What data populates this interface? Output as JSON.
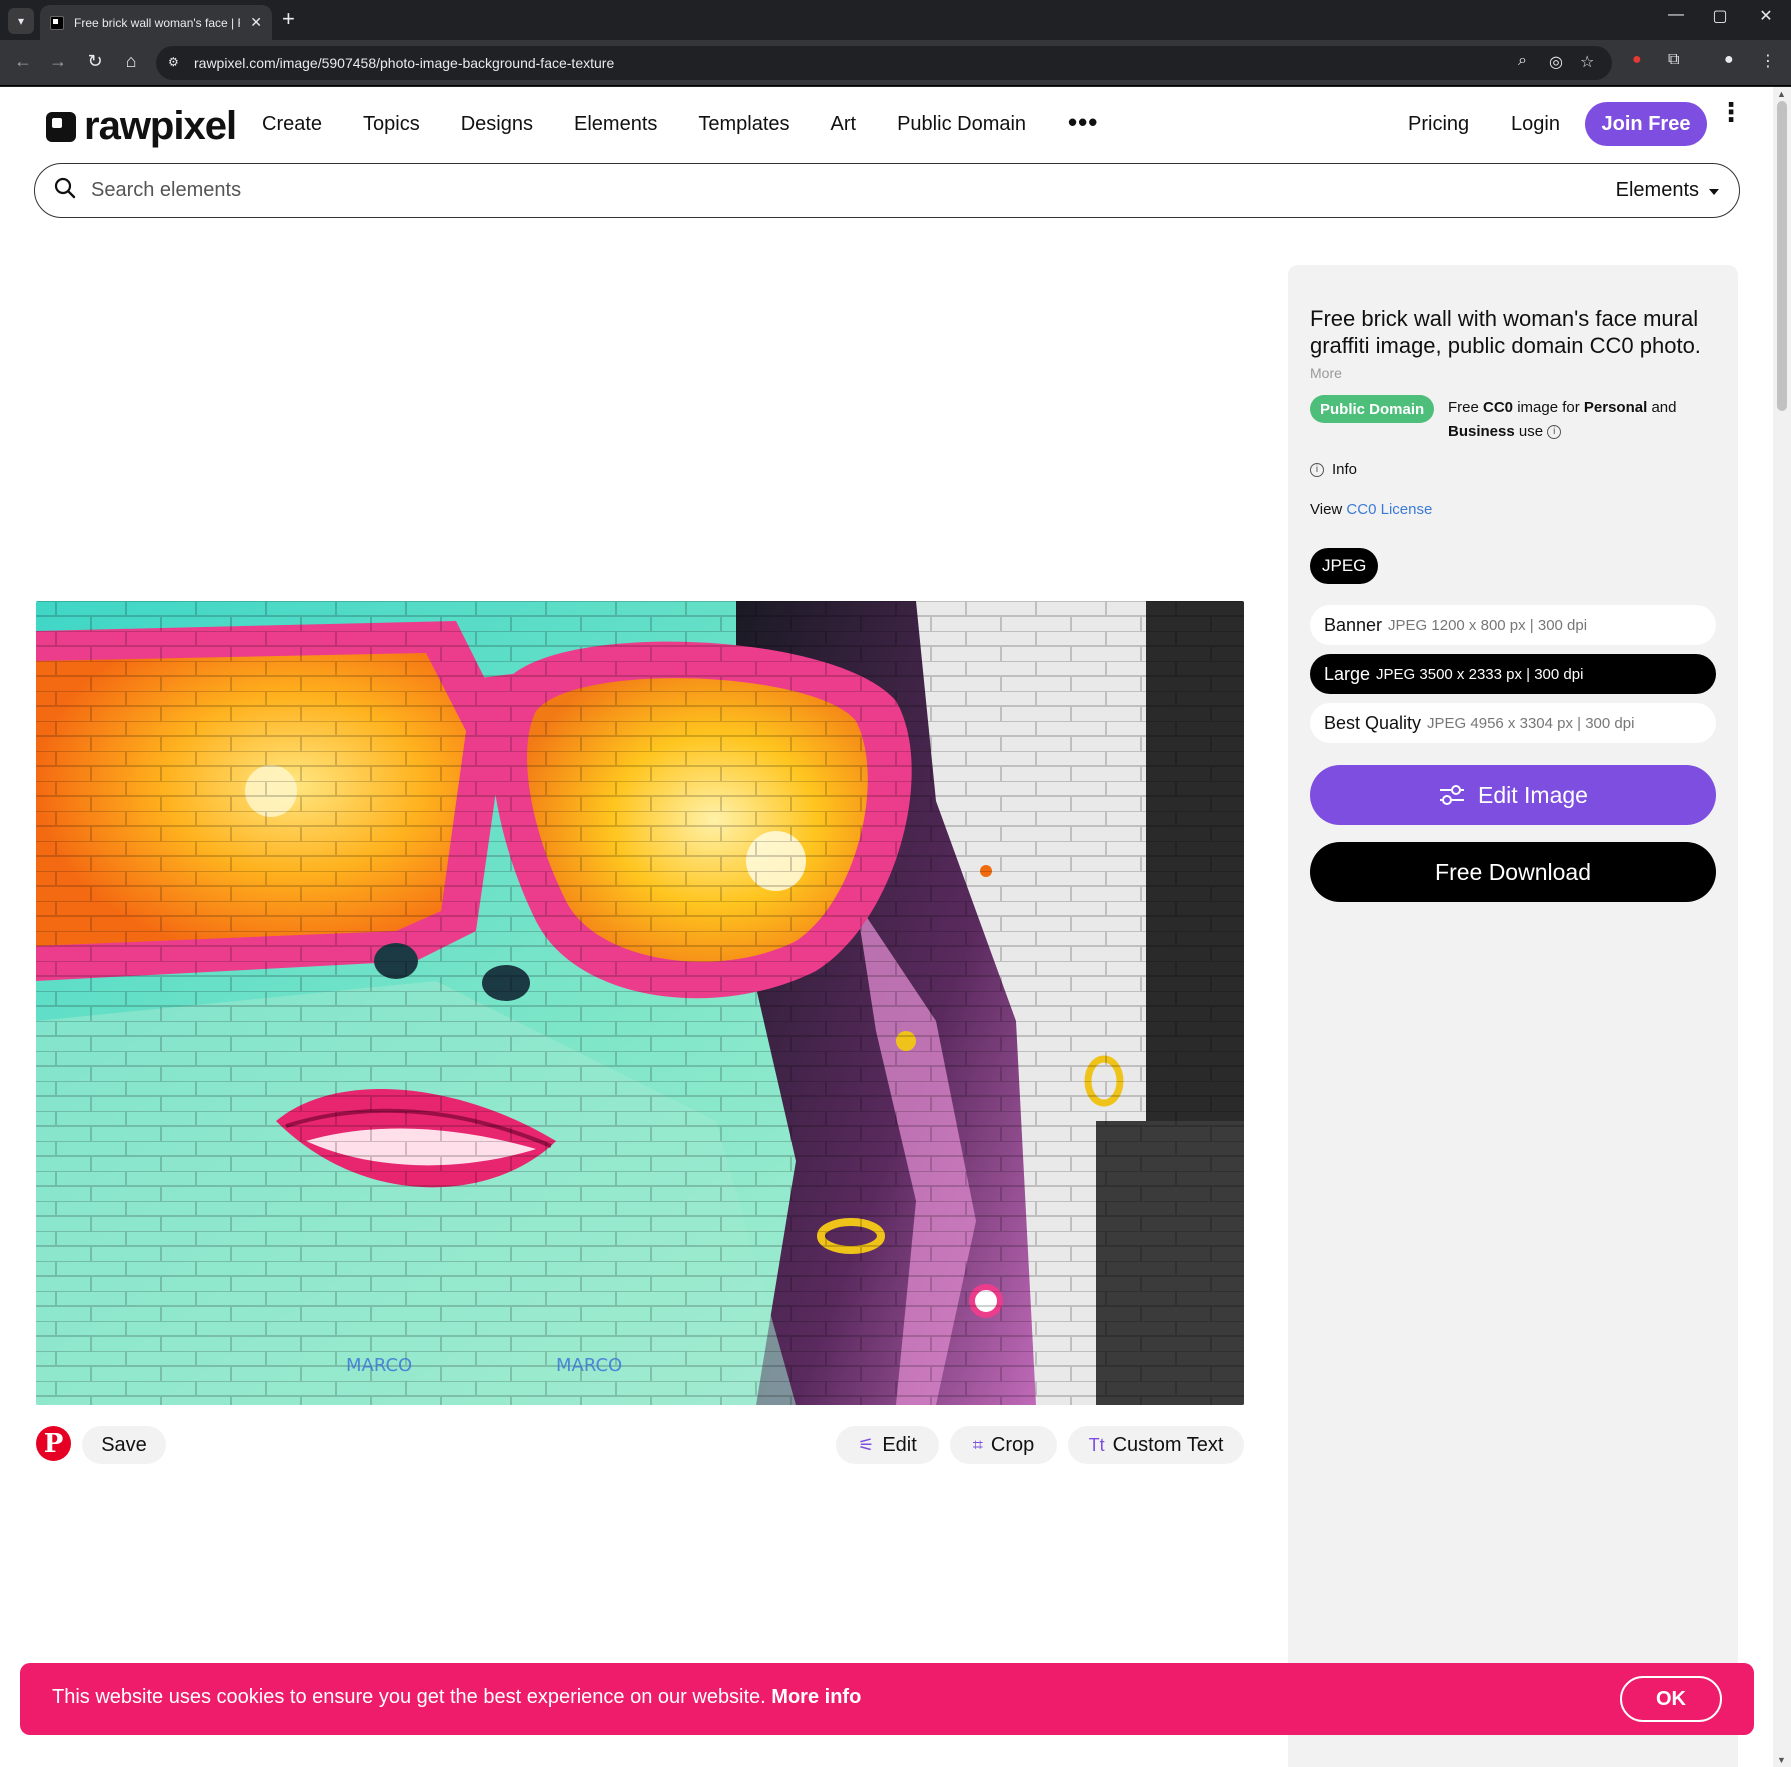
{
  "browser": {
    "tab_title": "Free brick wall woman's face | F",
    "tab_close": "✕",
    "new_tab": "+",
    "url": "rawpixel.com/image/5907458/photo-image-background-face-texture",
    "window_controls": [
      "—",
      "▢",
      "✕"
    ]
  },
  "header": {
    "logo_text": "rawpixel",
    "nav": [
      "Create",
      "Topics",
      "Designs",
      "Elements",
      "Templates",
      "Art",
      "Public Domain"
    ],
    "more": "•••",
    "pricing": "Pricing",
    "login": "Login",
    "join": "Join Free"
  },
  "search": {
    "placeholder": "Search elements",
    "category": "Elements"
  },
  "image": {
    "alt": "Free brick wall with woman's face mural graffiti image",
    "signatures": [
      "MARCO",
      "MARCO"
    ]
  },
  "actions": {
    "pin": "P",
    "save": "Save",
    "edit": "Edit",
    "crop": "Crop",
    "custom_text": "Custom Text"
  },
  "sidebar": {
    "title": "Free brick wall with woman's face mural graffiti image, public domain CC0 photo.",
    "more": "More",
    "badge": "Public Domain",
    "license_text_1": "Free ",
    "license_cc0": "CC0",
    "license_text_2": " image for ",
    "license_personal": "Personal",
    "license_text_3": " and ",
    "license_business": "Business",
    "license_text_4": " use",
    "info": "Info",
    "view_prefix": "View ",
    "view_link": "CC0 License",
    "format": "JPEG",
    "sizes": [
      {
        "name": "Banner",
        "meta": "JPEG 1200 x 800 px | 300 dpi",
        "selected": false
      },
      {
        "name": "Large",
        "meta": "JPEG 3500 x 2333 px | 300 dpi",
        "selected": true
      },
      {
        "name": "Best Quality",
        "meta": "JPEG 4956 x 3304 px | 300 dpi",
        "selected": false
      }
    ],
    "edit_image": "Edit Image",
    "free_download": "Free Download"
  },
  "cookie": {
    "text": "This website uses cookies to ensure you get the best experience on our website. ",
    "more_info": "More info",
    "ok": "OK"
  },
  "colors": {
    "accent_purple": "#7d4ee0",
    "cookie_pink": "#ee1c6a",
    "public_domain_green": "#4dbf7a",
    "pinterest_red": "#e60023"
  }
}
